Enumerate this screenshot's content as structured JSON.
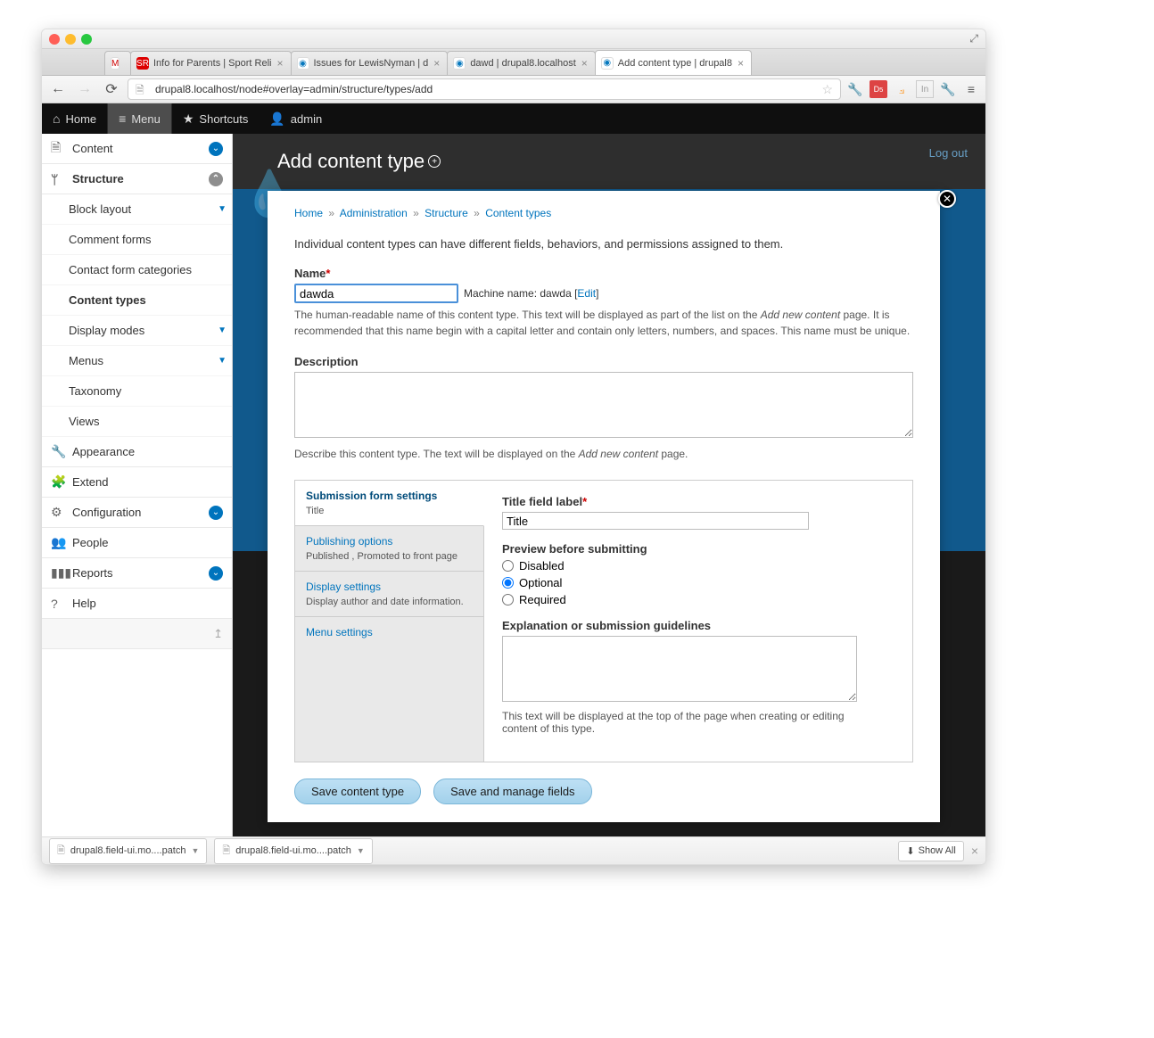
{
  "window": {
    "tabs": [
      {
        "title": ""
      },
      {
        "title": "Info for Parents | Sport Reli"
      },
      {
        "title": "Issues for LewisNyman | d"
      },
      {
        "title": "dawd | drupal8.localhost"
      },
      {
        "title": "Add content type | drupal8"
      }
    ],
    "url": "drupal8.localhost/node#overlay=admin/structure/types/add"
  },
  "toolbar": {
    "home": "Home",
    "menu": "Menu",
    "shortcuts": "Shortcuts",
    "admin": "admin"
  },
  "sidebar": {
    "content": "Content",
    "structure": "Structure",
    "sub": {
      "block_layout": "Block layout",
      "comment_forms": "Comment forms",
      "contact_form_categories": "Contact form categories",
      "content_types": "Content types",
      "display_modes": "Display modes",
      "menus": "Menus",
      "taxonomy": "Taxonomy",
      "views": "Views"
    },
    "appearance": "Appearance",
    "extend": "Extend",
    "configuration": "Configuration",
    "people": "People",
    "reports": "Reports",
    "help": "Help"
  },
  "header": {
    "title": "Add content type",
    "logout": "Log out"
  },
  "breadcrumb": {
    "home": "Home",
    "administration": "Administration",
    "structure": "Structure",
    "content_types": "Content types"
  },
  "form": {
    "intro": "Individual content types can have different fields, behaviors, and permissions assigned to them.",
    "name_label": "Name",
    "name_value": "dawda",
    "machine_name_prefix": "Machine name: dawda [",
    "machine_edit": "Edit",
    "machine_suffix": "]",
    "name_help_1": "The human-readable name of this content type. This text will be displayed as part of the list on the ",
    "name_help_em": "Add new content",
    "name_help_2": " page. It is recommended that this name begin with a capital letter and contain only letters, numbers, and spaces. This name must be unique.",
    "description_label": "Description",
    "description_help_1": "Describe this content type. The text will be displayed on the ",
    "description_help_em": "Add new content",
    "description_help_2": " page."
  },
  "vtabs": {
    "submission": {
      "title": "Submission form settings",
      "summary": "Title"
    },
    "publishing": {
      "title": "Publishing options",
      "summary": "Published , Promoted to front page"
    },
    "display": {
      "title": "Display settings",
      "summary": "Display author and date information."
    },
    "menu": {
      "title": "Menu settings",
      "summary": ""
    }
  },
  "panel": {
    "title_field_label": "Title field label",
    "title_field_value": "Title",
    "preview_label": "Preview before submitting",
    "opt_disabled": "Disabled",
    "opt_optional": "Optional",
    "opt_required": "Required",
    "explanation_label": "Explanation or submission guidelines",
    "explanation_help": "This text will be displayed at the top of the page when creating or editing content of this type."
  },
  "actions": {
    "save": "Save content type",
    "save_manage": "Save and manage fields"
  },
  "downloads": {
    "file1": "drupal8.field-ui.mo....patch",
    "file2": "drupal8.field-ui.mo....patch",
    "show_all": "Show All"
  }
}
